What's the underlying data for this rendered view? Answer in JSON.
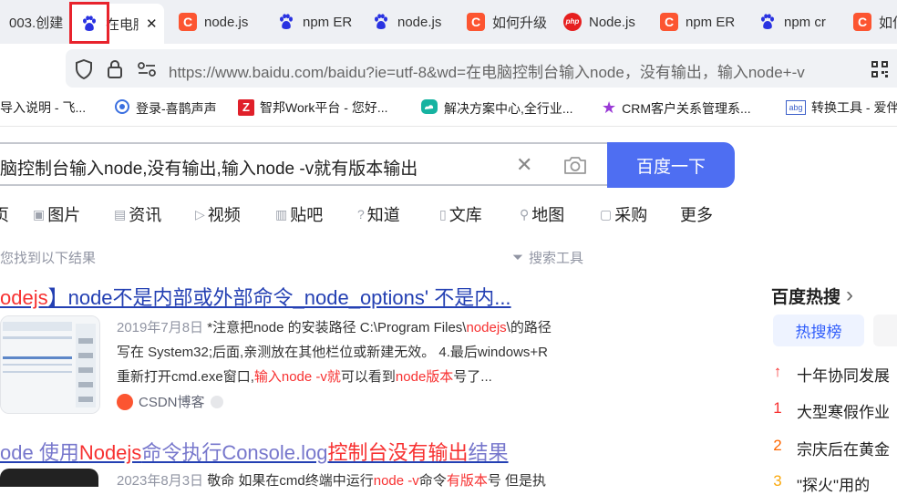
{
  "tabs": [
    {
      "label": "003.创建",
      "icon": "none"
    },
    {
      "label": "在电脑",
      "icon": "baidu-paw-icon",
      "active": true,
      "close": "✕"
    },
    {
      "label": "node.js",
      "icon": "csdn-icon"
    },
    {
      "label": "npm ER",
      "icon": "baidu-paw-icon"
    },
    {
      "label": "node.js",
      "icon": "baidu-paw-icon"
    },
    {
      "label": "如何升级",
      "icon": "csdn-icon"
    },
    {
      "label": "Node.js",
      "icon": "php-icon"
    },
    {
      "label": "npm ER",
      "icon": "csdn-icon"
    },
    {
      "label": "npm cr",
      "icon": "baidu-paw-icon"
    },
    {
      "label": "如何",
      "icon": "csdn-icon"
    }
  ],
  "icon_text": {
    "csdn": "C",
    "php": "php",
    "paw": "🐾"
  },
  "address": {
    "url": "https://www.baidu.com/baidu?ie=utf-8&wd=在电脑控制台输入node，没有输出，输入node+-v"
  },
  "bookmarks": [
    {
      "label": "导入说明 - 飞..."
    },
    {
      "label": "登录-喜鹊声声"
    },
    {
      "label": "智邦Work平台 - 您好..."
    },
    {
      "label": "解决方案中心,全行业..."
    },
    {
      "label": "CRM客户关系管理系..."
    },
    {
      "label": "转换工具 - 爱伴"
    }
  ],
  "bookmark_icons": {
    "z": "Z",
    "abg": "abg"
  },
  "search": {
    "query": "脑控制台输入node,没有输出,输入node -v就有版本输出",
    "clear": "✕",
    "button": "百度一下"
  },
  "nav": [
    {
      "label": "页",
      "icon": ""
    },
    {
      "label": "图片",
      "icon": "▣"
    },
    {
      "label": "资讯",
      "icon": "▤"
    },
    {
      "label": "视频",
      "icon": "▷"
    },
    {
      "label": "贴吧",
      "icon": "▥"
    },
    {
      "label": "知道",
      "icon": "?"
    },
    {
      "label": "文库",
      "icon": "▯"
    },
    {
      "label": "地图",
      "icon": "⚲"
    },
    {
      "label": "采购",
      "icon": "▢"
    },
    {
      "label": "更多",
      "icon": ""
    }
  ],
  "result_info": "您找到以下结果",
  "tools_label": "搜索工具",
  "tools_icon": "⏷",
  "results": [
    {
      "title_hl": "odejs",
      "title_rest": "】node不是内部或外部命令_node_options' 不是内...",
      "date": "2019年7月8日",
      "l1_a": "*注意把node 的安装路径 C:\\Program Files\\",
      "l1_red": "nodejs",
      "l1_b": "\\的路径",
      "line2": "写在 System32;后面,亲测放在其他栏位或新建无效。 4.最后windows+R",
      "l3_a": "重新打开cmd.exe窗口,",
      "l3_red1": "输入node -v就",
      "l3_b": "可以看到",
      "l3_red2": "node版本",
      "l3_c": "号了...",
      "source": "CSDN博客",
      "source_icon": "csdn"
    },
    {
      "t_a": "ode 使用",
      "t_hl1": "Nodejs",
      "t_b": "命令执行Console.log",
      "t_hl2": "控制台没有输出",
      "t_c": "结果",
      "snippet_a": "2023年8月3日",
      "snippet_b": "敬命 如果在cmd终端中运行",
      "snippet_red1": "node -v",
      "snippet_c": "命令",
      "snippet_red2": "有版本",
      "snippet_d": "号 但是执"
    }
  ],
  "hot": {
    "title": "百度热搜",
    "chev": "›",
    "tab": "热搜榜",
    "items": [
      {
        "rank": "↑",
        "text": "十年协同发展"
      },
      {
        "rank": "1",
        "text": "大型寒假作业"
      },
      {
        "rank": "2",
        "text": "宗庆后在黄金"
      },
      {
        "rank": "3",
        "text": "\"探火\"用的"
      }
    ]
  },
  "colors": {
    "accent": "#4e6ef2",
    "link": "#2440b3",
    "highlight": "#f73131",
    "hot_rank_top": "#f73131",
    "hot_rank_3": "#ff8105"
  }
}
